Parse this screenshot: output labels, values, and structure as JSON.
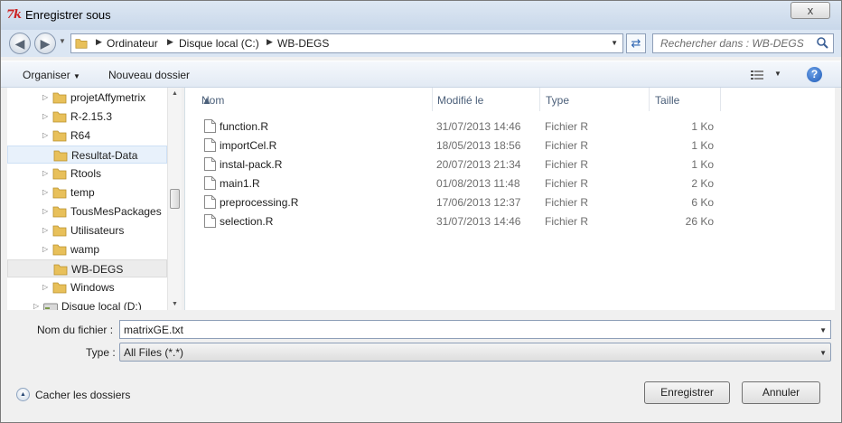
{
  "window": {
    "title": "Enregistrer sous",
    "icon_text": "7k",
    "close_label": "x"
  },
  "nav": {
    "breadcrumbs": [
      "Ordinateur",
      "Disque local (C:)",
      "WB-DEGS"
    ],
    "search_placeholder": "Rechercher dans : WB-DEGS"
  },
  "toolbar": {
    "organiser_label": "Organiser",
    "new_folder_label": "Nouveau dossier"
  },
  "tree": {
    "items": [
      {
        "label": "projetAffymetrix"
      },
      {
        "label": "R-2.15.3"
      },
      {
        "label": "R64"
      },
      {
        "label": "Resultat-Data"
      },
      {
        "label": "Rtools"
      },
      {
        "label": "temp"
      },
      {
        "label": "TousMesPackages"
      },
      {
        "label": "Utilisateurs"
      },
      {
        "label": "wamp"
      },
      {
        "label": "WB-DEGS"
      },
      {
        "label": "Windows"
      },
      {
        "label": "Disque local (D:)"
      }
    ]
  },
  "filelist": {
    "columns": {
      "name": "Nom",
      "modified": "Modifié le",
      "type": "Type",
      "size": "Taille"
    },
    "files": [
      {
        "name": "function.R",
        "modified": "31/07/2013 14:46",
        "type": "Fichier R",
        "size": "1 Ko"
      },
      {
        "name": "importCel.R",
        "modified": "18/05/2013 18:56",
        "type": "Fichier R",
        "size": "1 Ko"
      },
      {
        "name": "instal-pack.R",
        "modified": "20/07/2013 21:34",
        "type": "Fichier R",
        "size": "1 Ko"
      },
      {
        "name": "main1.R",
        "modified": "01/08/2013 11:48",
        "type": "Fichier R",
        "size": "2 Ko"
      },
      {
        "name": "preprocessing.R",
        "modified": "17/06/2013 12:37",
        "type": "Fichier R",
        "size": "6 Ko"
      },
      {
        "name": "selection.R",
        "modified": "31/07/2013 14:46",
        "type": "Fichier R",
        "size": "26 Ko"
      }
    ]
  },
  "form": {
    "filename_label": "Nom du fichier :",
    "filename_value": "matrixGE.txt",
    "type_label": "Type :",
    "type_value": "All Files (*.*)"
  },
  "footer": {
    "hide_folders_label": "Cacher les dossiers",
    "save_label": "Enregistrer",
    "cancel_label": "Annuler"
  }
}
